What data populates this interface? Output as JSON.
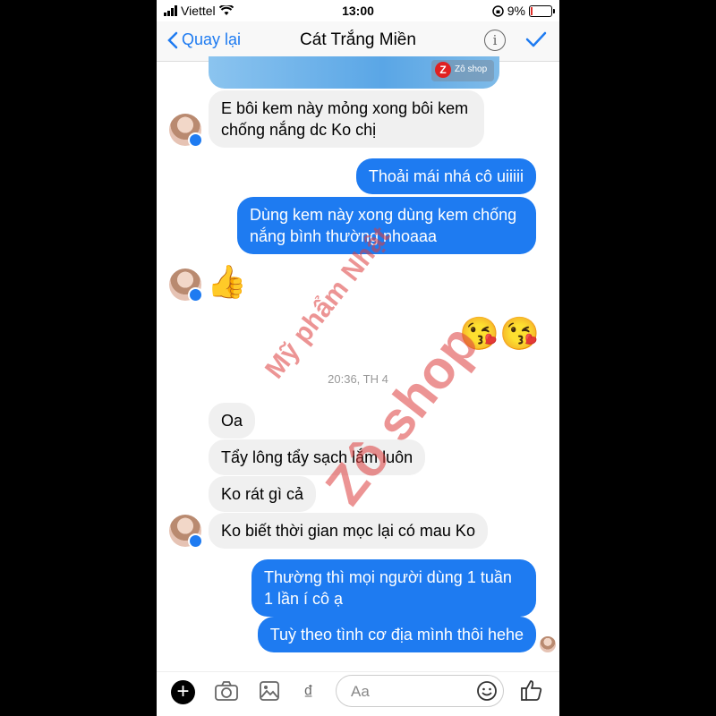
{
  "status_bar": {
    "carrier": "Viettel",
    "time": "13:00",
    "battery": "9%",
    "battery_level": 0.09
  },
  "header": {
    "back_label": "Quay lại",
    "title": "Cát Trắng Miền"
  },
  "attachment": {
    "logo_letter": "Z",
    "logo_text": "Zô shop"
  },
  "messages": [
    {
      "side": "in",
      "text": "E bôi kem này mỏng xong bôi kem chống nắng dc Ko chị"
    },
    {
      "side": "out",
      "text": "Thoải mái nhá cô uiiiii"
    },
    {
      "side": "out",
      "text": "Dùng kem này xong dùng kem chống nắng bình thường nhoaaa"
    },
    {
      "side": "in",
      "text": "👍"
    },
    {
      "side": "out",
      "text": "😘😘"
    },
    {
      "side": "in",
      "text": "Oa"
    },
    {
      "side": "in",
      "text": "Tẩy lông tẩy sạch lắm luôn"
    },
    {
      "side": "in",
      "text": "Ko rát gì cả"
    },
    {
      "side": "in",
      "text": "Ko biết thời gian mọc lại có mau Ko"
    },
    {
      "side": "out",
      "text": "Thường thì mọi người dùng 1 tuần 1 lần í cô ạ"
    },
    {
      "side": "out",
      "text": "Tuỳ theo tình cơ địa mình thôi hehe"
    }
  ],
  "timestamp": "20:36, TH 4",
  "watermark": {
    "line1": "Mỹ phẩm Nhật",
    "line2": "Zô shop"
  },
  "composer": {
    "placeholder": "Aa",
    "currency_symbol": "₫",
    "plus_symbol": "+"
  },
  "colors": {
    "accent": "#1e7bf1",
    "incoming_bubble": "#f0f0f0"
  }
}
